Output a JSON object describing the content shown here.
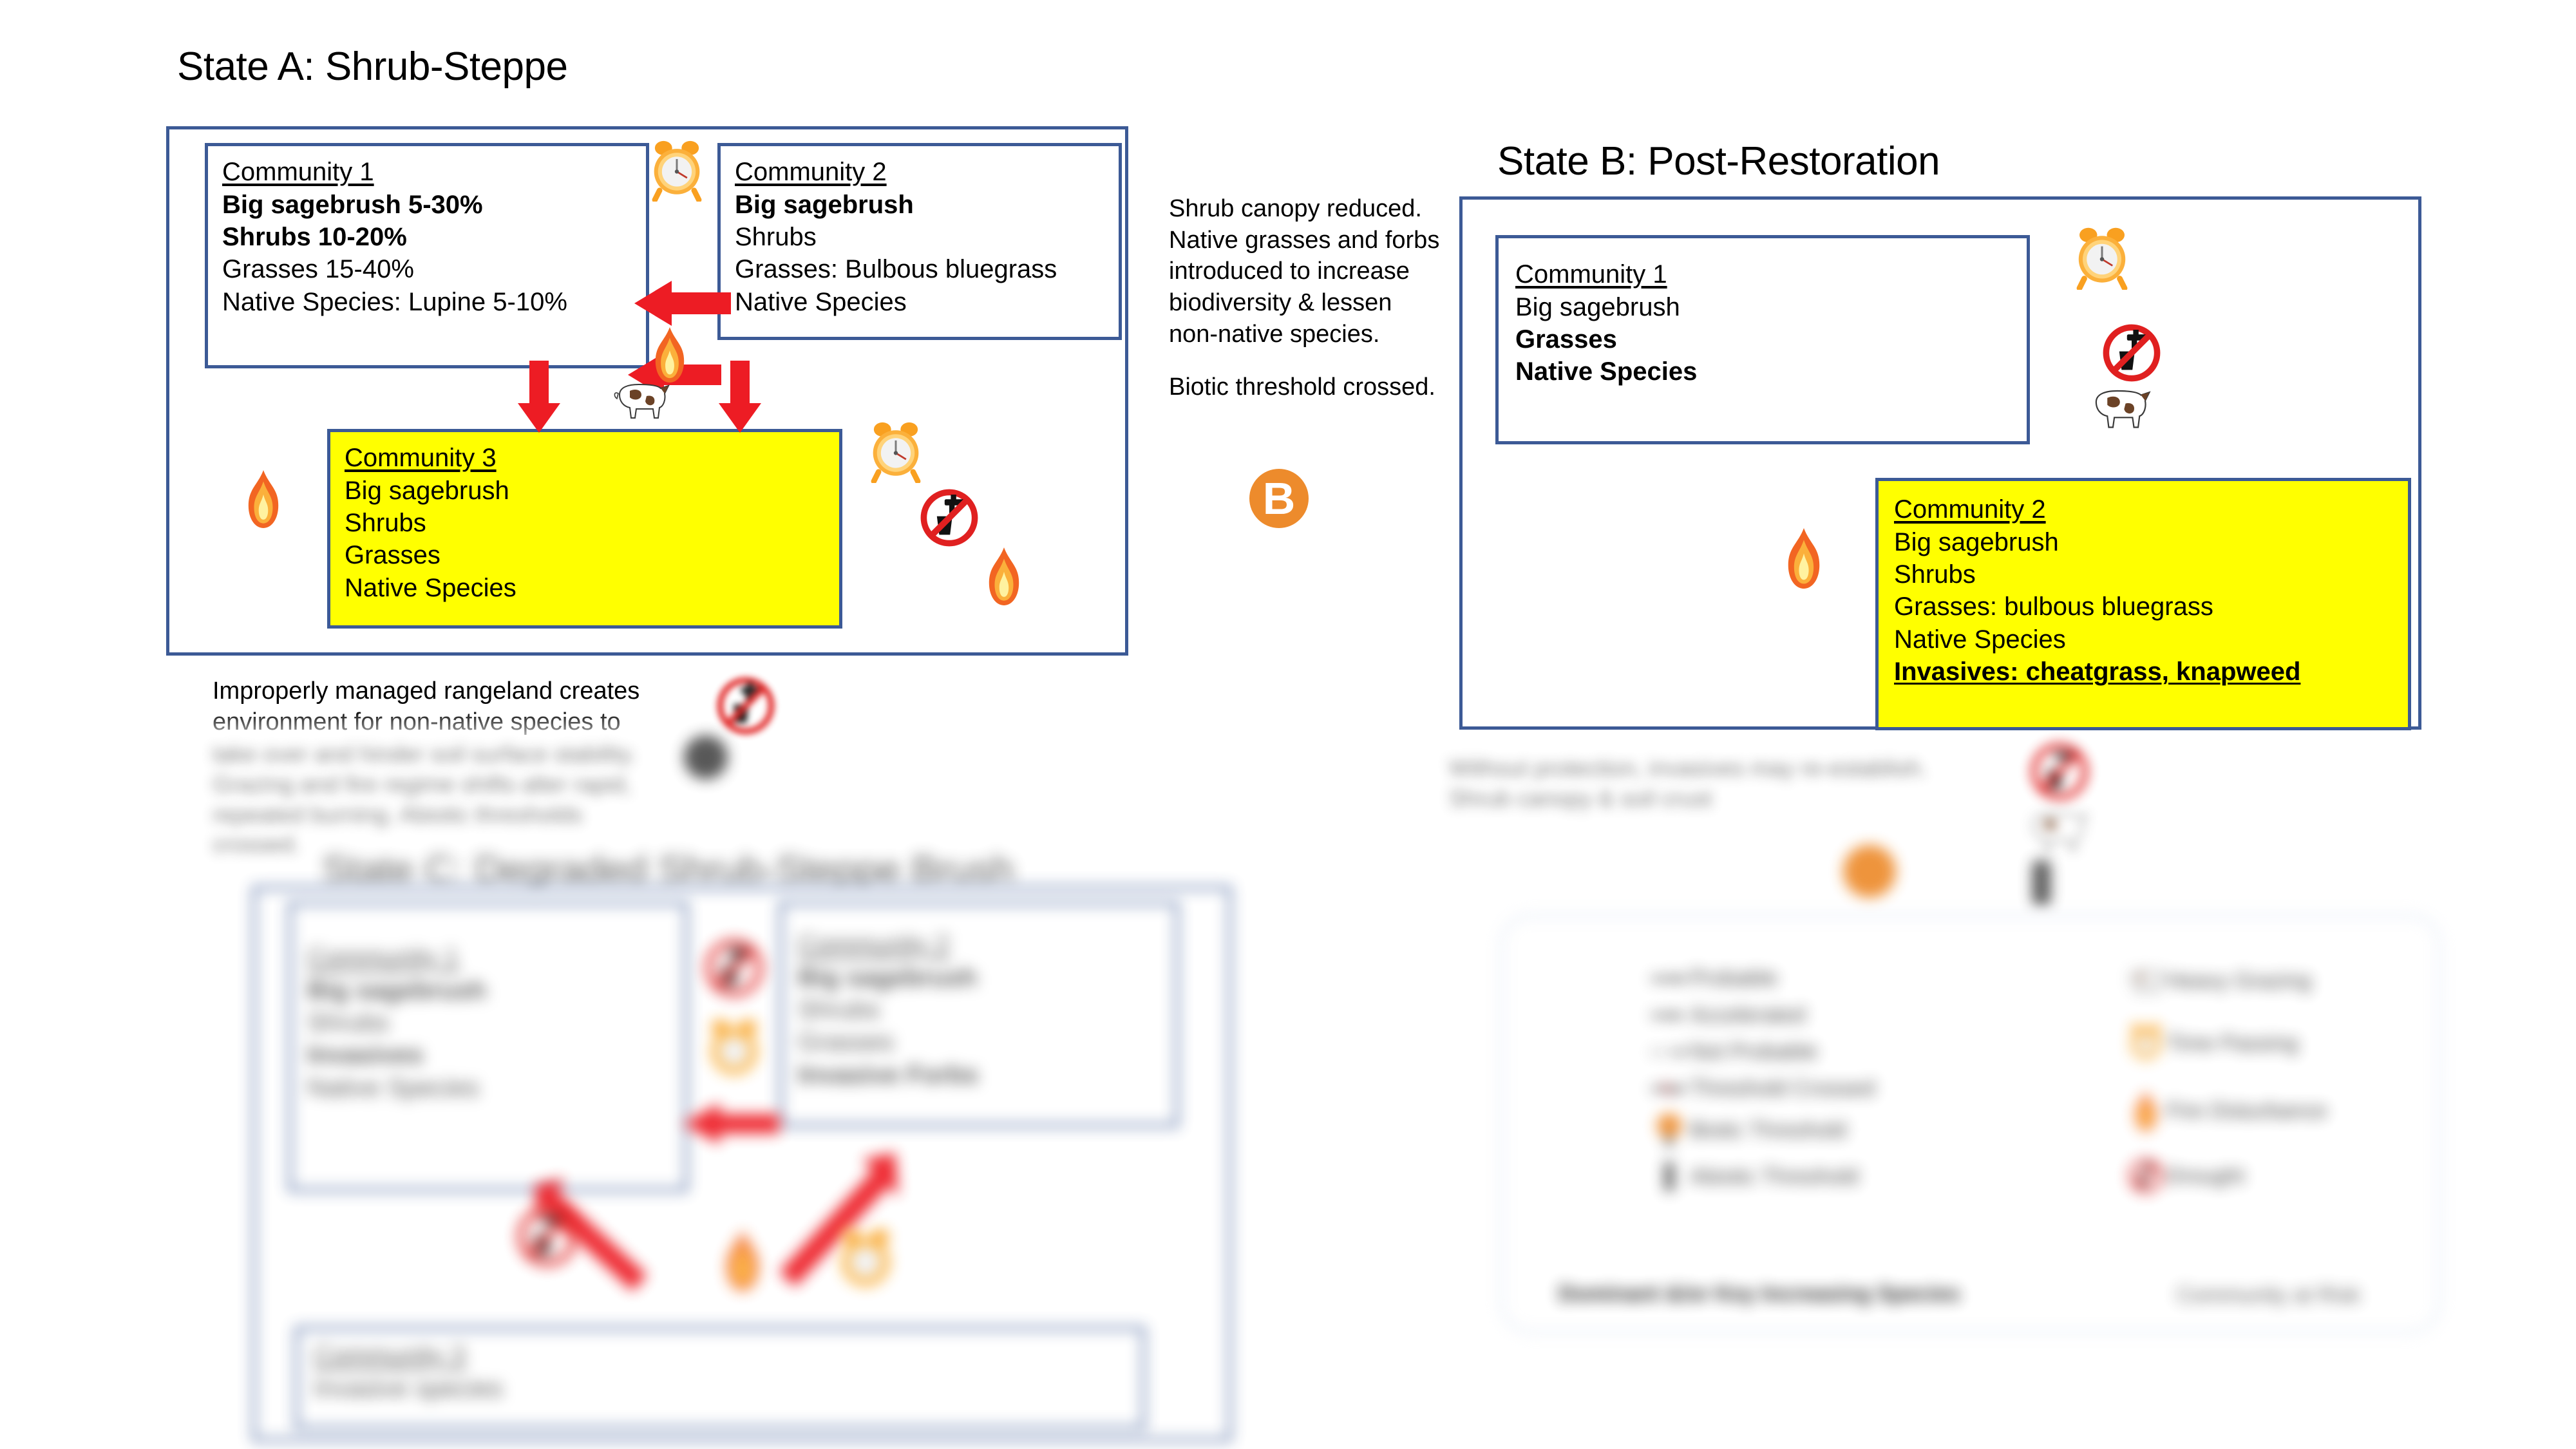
{
  "colors": {
    "frame_blue": "#3c5a96",
    "highlight_yellow": "#FFFF00",
    "arrow_red": "#ED1C24",
    "threshold_orange": "#ED8B2C",
    "prohibition_red": "#E02020"
  },
  "state_a": {
    "title": "State A: Shrub-Steppe",
    "community_1": {
      "heading": "Community 1",
      "lines": [
        {
          "text": "Big sagebrush 5-30%",
          "bold": true
        },
        {
          "text": "Shrubs 10-20%",
          "bold": true
        },
        {
          "text": "Grasses 15-40%",
          "bold": false
        },
        {
          "text": "Native Species: Lupine 5-10%",
          "bold": false
        }
      ]
    },
    "community_2": {
      "heading": "Community 2",
      "lines": [
        {
          "text": "Big sagebrush",
          "bold": true
        },
        {
          "text": "Shrubs",
          "bold": false
        },
        {
          "text": "Grasses: Bulbous bluegrass",
          "bold": false
        },
        {
          "text": "Native Species",
          "bold": false
        }
      ]
    },
    "community_3": {
      "heading": "Community 3",
      "lines": [
        {
          "text": "Big sagebrush",
          "bold": false
        },
        {
          "text": "Shrubs",
          "bold": false
        },
        {
          "text": "Grasses",
          "bold": false
        },
        {
          "text": "Native Species",
          "bold": false
        }
      ]
    },
    "caption": "Improperly managed rangeland creates environment for non-native species to"
  },
  "transition_ab": {
    "paragraph_1": "Shrub canopy reduced. Native grasses and forbs introduced to increase biodiversity & lessen non-native species.",
    "paragraph_2": "Biotic threshold crossed.",
    "badge": "B"
  },
  "state_b": {
    "title": "State B: Post-Restoration",
    "community_1": {
      "heading": "Community 1",
      "lines": [
        {
          "text": "Big sagebrush",
          "bold": false
        },
        {
          "text": "Grasses",
          "bold": true
        },
        {
          "text": "Native Species",
          "bold": true
        }
      ]
    },
    "community_2": {
      "heading": "Community 2",
      "lines": [
        {
          "text": "Big sagebrush",
          "bold": false,
          "underline": false
        },
        {
          "text": "Shrubs",
          "bold": false,
          "underline": false
        },
        {
          "text": "Grasses: bulbous bluegrass",
          "bold": false,
          "underline": false
        },
        {
          "text": "Native Species",
          "bold": false,
          "underline": false
        },
        {
          "text": "Invasives: cheatgrass, knapweed",
          "bold": true,
          "underline": true
        }
      ]
    },
    "caption": "Without protection, invasives may re-establish. Shrub canopy & soil crust"
  },
  "state_c": {
    "title": "State C: Degraded Shrub-Steppe Brush",
    "community_1": {
      "heading": "Community 1",
      "lines": [
        {
          "text": "Big sagebrush",
          "bold": true
        },
        {
          "text": "Shrubs",
          "bold": false
        },
        {
          "text": "Invasives",
          "bold": true
        },
        {
          "text": "Native Species",
          "bold": false
        }
      ]
    },
    "community_2": {
      "heading": "Community 2",
      "lines": [
        {
          "text": "Big sagebrush",
          "bold": true
        },
        {
          "text": "Shrubs",
          "bold": false
        },
        {
          "text": "Grasses",
          "bold": false
        },
        {
          "text": "Invasive Forbs",
          "bold": true
        }
      ]
    },
    "community_3": {
      "heading": "Community 3",
      "lines": [
        {
          "text": "Invasive species",
          "bold": false
        }
      ]
    }
  },
  "legend": {
    "left_items": [
      {
        "label": "Probable",
        "icon": "solid-arrow"
      },
      {
        "label": "Accelerated",
        "icon": "double-arrow"
      },
      {
        "label": "Not Probable",
        "icon": "dashed-arrow"
      },
      {
        "label": "Threshold Crossed",
        "icon": "cross-arrow"
      },
      {
        "label": "Biotic Threshold",
        "icon": "biotic-threshold-icon"
      },
      {
        "label": "Abiotic Threshold",
        "icon": "abiotic-threshold-icon"
      }
    ],
    "right_items": [
      {
        "label": "Heavy Grazing",
        "icon": "cow-icon"
      },
      {
        "label": "Time Passing",
        "icon": "alarm-clock-icon"
      },
      {
        "label": "Fire Disturbance",
        "icon": "flame-icon"
      },
      {
        "label": "Drought",
        "icon": "no-water-icon"
      }
    ],
    "footer_left": "Dominant &/or Key Increasing Species",
    "footer_right": "Community at Risk"
  }
}
